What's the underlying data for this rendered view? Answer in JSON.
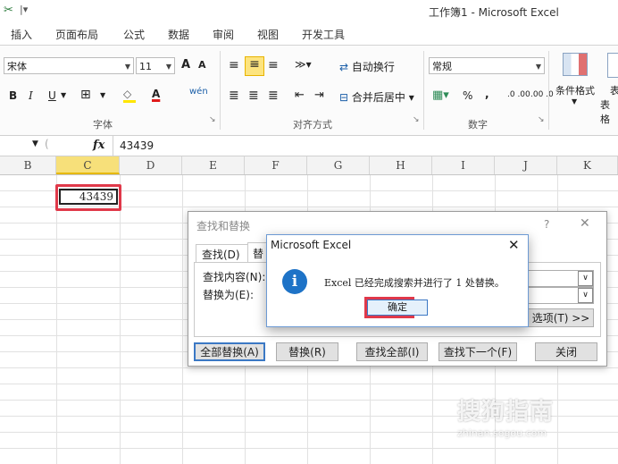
{
  "window": {
    "title": "工作簿1 - Microsoft Excel"
  },
  "tabs": [
    "插入",
    "页面布局",
    "公式",
    "数据",
    "审阅",
    "视图",
    "开发工具"
  ],
  "ribbon": {
    "font": {
      "name": "宋体",
      "size": "11",
      "group_label": "字体",
      "grow": "A",
      "shrink": "A"
    },
    "format_buttons": [
      "B",
      "I",
      "U"
    ],
    "wen": "wén",
    "alignment": {
      "wrap_label": "自动换行",
      "merge_label": "合并后居中",
      "group_label": "对齐方式"
    },
    "number": {
      "format": "常规",
      "percent": "%",
      "comma": ",",
      "group_label": "数字",
      "inc": ".0 .00",
      "dec": ".00 .0"
    },
    "styles": {
      "conditional_label": "条件格式",
      "partial1": "表格",
      "partial2": "表"
    }
  },
  "formula_bar": {
    "fx": "fx",
    "value": "43439"
  },
  "columns": [
    "B",
    "C",
    "D",
    "E",
    "F",
    "G",
    "H",
    "I",
    "J",
    "K"
  ],
  "cell_c2": "43439",
  "find_dialog": {
    "title": "查找和替换",
    "help": "?",
    "close": "✕",
    "tab_find": "查找(D)",
    "tab_replace": "替",
    "find_label": "查找内容(N):",
    "replace_label": "替换为(E):",
    "options_btn": "选项(T) >>",
    "btn_replace_all": "全部替换(A)",
    "btn_replace": "替换(R)",
    "btn_find_all": "查找全部(I)",
    "btn_find_next": "查找下一个(F)",
    "btn_close": "关闭"
  },
  "message_box": {
    "title": "Microsoft Excel",
    "close": "✕",
    "text": "Excel 已经完成搜索并进行了 1 处替换。",
    "ok": "确定"
  },
  "watermark": {
    "text": "搜狗指南",
    "url": "zhinan.sogou.com"
  },
  "colors": {
    "highlight_red": "#e0394a",
    "info_blue": "#1e73c7",
    "selected_col": "#f7e07a",
    "dialog_accent": "#3b78c4"
  }
}
